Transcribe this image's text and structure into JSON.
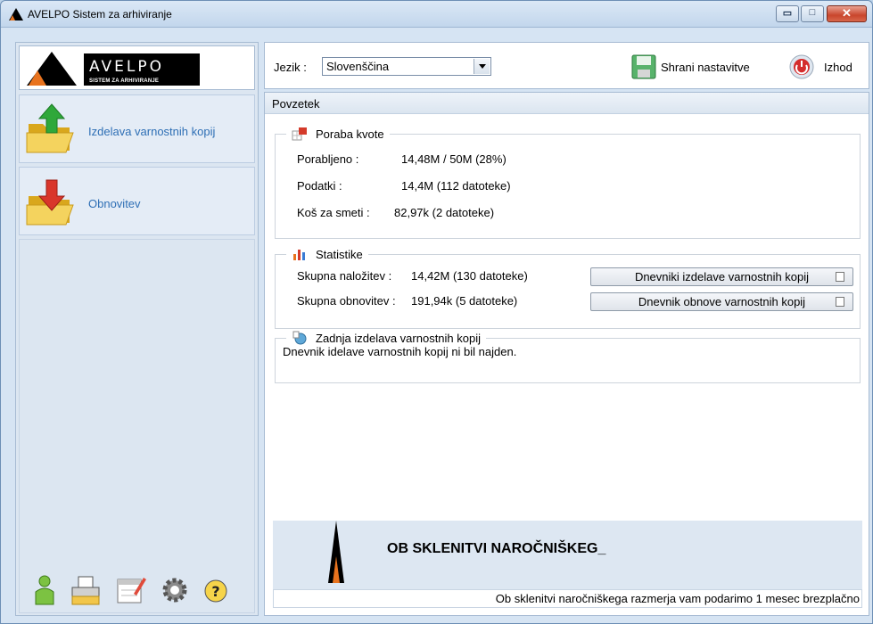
{
  "window": {
    "title": "AVELPO Sistem za arhiviranje"
  },
  "logo": {
    "word": "AVELPO",
    "subtitle": "SISTEM ZA ARHIVIRANJE"
  },
  "sidebar": {
    "items": [
      {
        "label": "Izdelava varnostnih kopij"
      },
      {
        "label": "Obnovitev"
      }
    ],
    "tools": [
      "user-icon",
      "printer-icon",
      "calendar-edit-icon",
      "gear-icon",
      "help-icon"
    ]
  },
  "toolbar": {
    "language_label": "Jezik :",
    "language_value": "Slovenščina",
    "save_label": "Shrani nastavitve",
    "exit_label": "Izhod"
  },
  "summary": {
    "title": "Povzetek",
    "quota": {
      "title": "Poraba kvote",
      "used_label": "Porabljeno :",
      "used_value": "14,48M / 50M (28%)",
      "data_label": "Podatki :",
      "data_value": "14,4M  (112 datoteke)",
      "trash_label": "Koš za smeti :",
      "trash_value": "82,97k  (2 datoteke)"
    },
    "stats": {
      "title": "Statistike",
      "uploads_label": "Skupna naložitev :",
      "uploads_value": "14,42M  (130 datoteke)",
      "restores_label": "Skupna obnovitev :",
      "restores_value": "191,94k  (5 datoteke)",
      "backup_logs_button": "Dnevniki izdelave varnostnih kopij",
      "restore_log_button": "Dnevnik obnove varnostnih kopij"
    },
    "last_backup": {
      "title": "Zadnja izdelava varnostnih kopij",
      "message": "Dnevnik idelave varnostnih kopij ni bil najden."
    }
  },
  "banner": {
    "title": "OB SKLENITVI NAROČNIŠKEG_",
    "ticker": "Ob sklenitvi naročniškega razmerja vam podarimo 1 mesec brezplačno"
  },
  "colors": {
    "accent": "#2e6fb5",
    "brand_orange": "#e8731e",
    "close_red": "#c9462c"
  }
}
